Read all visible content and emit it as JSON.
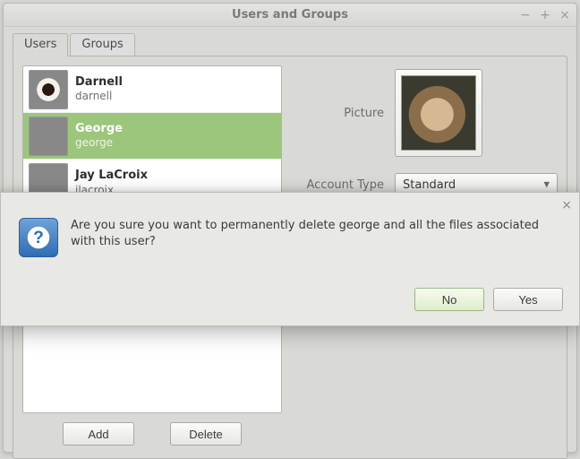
{
  "window": {
    "title": "Users and Groups"
  },
  "tabs": {
    "users": "Users",
    "groups": "Groups"
  },
  "users": [
    {
      "fullname": "Darnell",
      "username": "darnell"
    },
    {
      "fullname": "George",
      "username": "george"
    },
    {
      "fullname": "Jay LaCroix",
      "username": "jlacroix"
    }
  ],
  "selected_index": 1,
  "buttons": {
    "add": "Add",
    "delete": "Delete"
  },
  "right": {
    "picture_label": "Picture",
    "account_type_label": "Account Type",
    "account_type_value": "Standard"
  },
  "dialog": {
    "message": "Are you sure you want to permanently delete george and all the files associated with this user?",
    "no": "No",
    "yes": "Yes"
  }
}
